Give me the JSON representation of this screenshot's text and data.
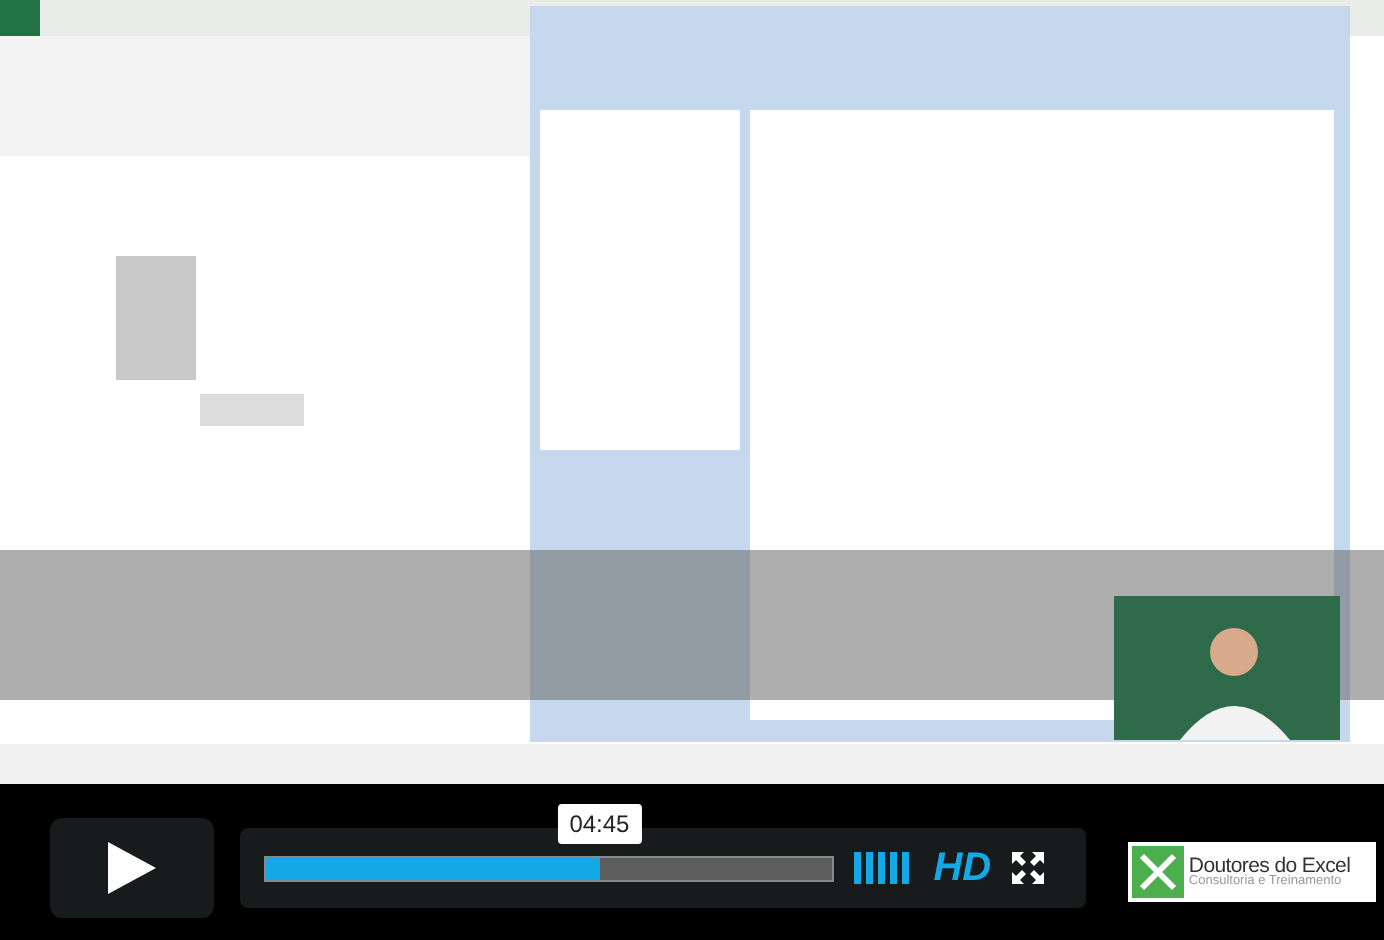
{
  "player": {
    "time_tooltip": "04:45",
    "progress": {
      "level": 0.59
    },
    "quality": "HD",
    "logo": {
      "name": "Doutores do Excel",
      "tagline": "Consultoria e Treinamento"
    }
  }
}
